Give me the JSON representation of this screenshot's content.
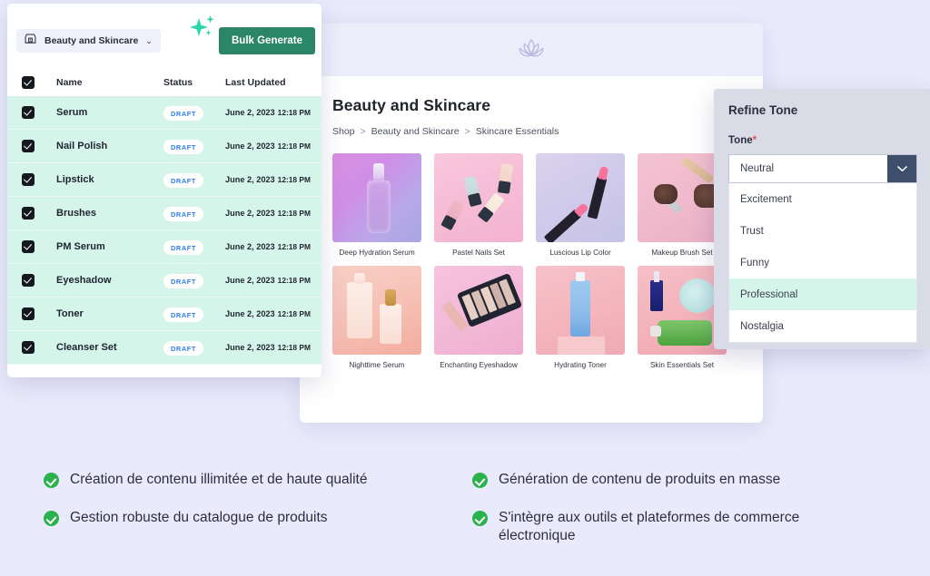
{
  "product_page": {
    "logo_icon": "lotus-icon",
    "title": "Beauty and Skincare",
    "breadcrumb": [
      "Shop",
      "Beauty and Skincare",
      "Skincare Essentials"
    ],
    "breadcrumb_separator": ">",
    "tiles": [
      {
        "label": "Deep Hydration Serum"
      },
      {
        "label": "Pastel Nails Set"
      },
      {
        "label": "Luscious Lip Color"
      },
      {
        "label": "Makeup Brush Set"
      },
      {
        "label": "Nighttime Serum"
      },
      {
        "label": "Enchanting Eyeshadow"
      },
      {
        "label": "Hydrating Toner"
      },
      {
        "label": "Skin Essentials Set"
      }
    ]
  },
  "list_panel": {
    "store_icon": "storefront-icon",
    "store_name": "Beauty and Skincare",
    "store_caret": "⌄",
    "sparkle_icon": "sparkle-icon",
    "bulk_generate_label": "Bulk Generate",
    "columns": [
      "Name",
      "Status",
      "Last Updated"
    ],
    "rows": [
      {
        "name": "Serum",
        "status": "DRAFT",
        "date": "June 2, 2023",
        "time": "12:18 PM"
      },
      {
        "name": "Nail Polish",
        "status": "DRAFT",
        "date": "June 2, 2023",
        "time": "12:18 PM"
      },
      {
        "name": "Lipstick",
        "status": "DRAFT",
        "date": "June 2, 2023",
        "time": "12:18 PM"
      },
      {
        "name": "Brushes",
        "status": "DRAFT",
        "date": "June 2, 2023",
        "time": "12:18 PM"
      },
      {
        "name": "PM Serum",
        "status": "DRAFT",
        "date": "June 2, 2023",
        "time": "12:18 PM"
      },
      {
        "name": "Eyeshadow",
        "status": "DRAFT",
        "date": "June 2, 2023",
        "time": "12:18 PM"
      },
      {
        "name": "Toner",
        "status": "DRAFT",
        "date": "June 2, 2023",
        "time": "12:18 PM"
      },
      {
        "name": "Cleanser Set",
        "status": "DRAFT",
        "date": "June 2, 2023",
        "time": "12:18 PM"
      }
    ]
  },
  "tone_panel": {
    "title": "Refine Tone",
    "field_label": "Tone",
    "required_marker": "*",
    "selected_value": "Neutral",
    "dropdown_icon": "chevron-down-icon",
    "options": [
      "Excitement",
      "Trust",
      "Funny",
      "Professional",
      "Nostalgia"
    ],
    "highlighted_option": "Professional"
  },
  "features": [
    "Création de contenu illimitée et de haute qualité",
    "Génération de contenu de produits en masse",
    "Gestion robuste du catalogue de produits",
    "S'intègre aux outils et plateformes de commerce électronique"
  ],
  "colors": {
    "page_background": "#e9eafb",
    "accent_green": "#2b8567",
    "row_highlight": "#d6f5ea",
    "badge_text": "#2f7ef0",
    "check_green": "#2bb24c",
    "select_arrow": "#3e4f6b",
    "required_red": "#ef4b5e"
  }
}
